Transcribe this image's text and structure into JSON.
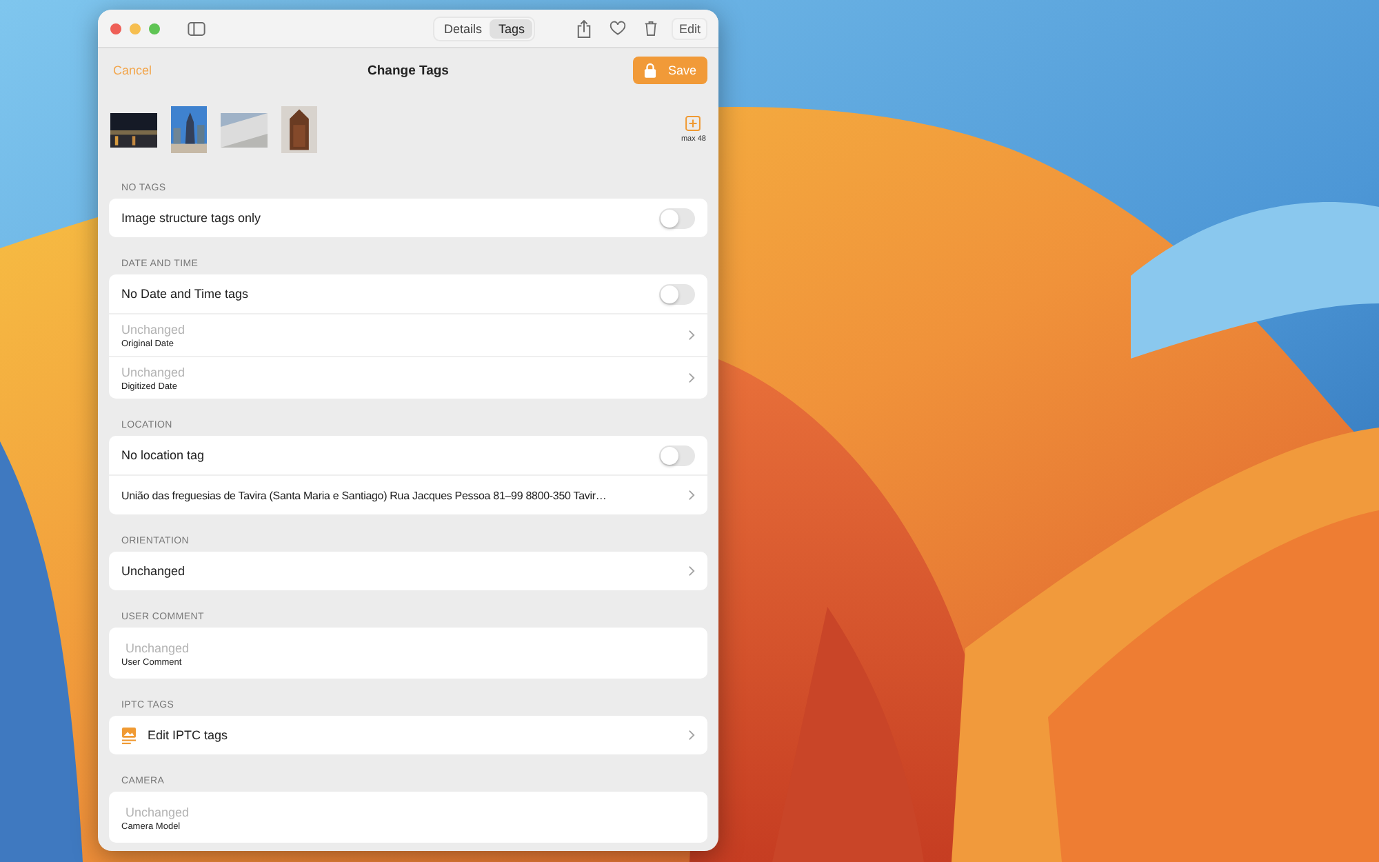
{
  "window": {
    "segments": [
      {
        "label": "Details",
        "selected": false
      },
      {
        "label": "Tags",
        "selected": true
      }
    ],
    "edit_button": "Edit"
  },
  "nav": {
    "cancel": "Cancel",
    "title": "Change Tags",
    "save": "Save"
  },
  "add_limit": "max 48",
  "sections": [
    {
      "header": "NO TAGS",
      "rows": [
        {
          "kind": "toggle",
          "label": "Image structure tags only",
          "on": false
        }
      ]
    },
    {
      "header": "DATE AND TIME",
      "rows": [
        {
          "kind": "toggle",
          "label": "No Date and Time tags",
          "on": false
        },
        {
          "kind": "picker",
          "placeholder": "Unchanged",
          "caption": "Original Date"
        },
        {
          "kind": "picker",
          "placeholder": "Unchanged",
          "caption": "Digitized Date"
        }
      ]
    },
    {
      "header": "LOCATION",
      "rows": [
        {
          "kind": "toggle",
          "label": "No location tag",
          "on": false
        },
        {
          "kind": "link",
          "label": "União das freguesias de Tavira (Santa Maria e Santiago) Rua Jacques Pessoa 81–99 8800-350 Tavir…"
        }
      ]
    },
    {
      "header": "ORIENTATION",
      "rows": [
        {
          "kind": "link",
          "label": "Unchanged"
        }
      ]
    },
    {
      "header": "USER COMMENT",
      "rows": [
        {
          "kind": "field",
          "placeholder": "Unchanged",
          "caption": "User Comment"
        }
      ]
    },
    {
      "header": "IPTC TAGS",
      "rows": [
        {
          "kind": "iconlink",
          "label": "Edit IPTC tags"
        }
      ]
    },
    {
      "header": "CAMERA",
      "rows": [
        {
          "kind": "field",
          "placeholder": "Unchanged",
          "caption": "Camera Model"
        }
      ]
    }
  ]
}
